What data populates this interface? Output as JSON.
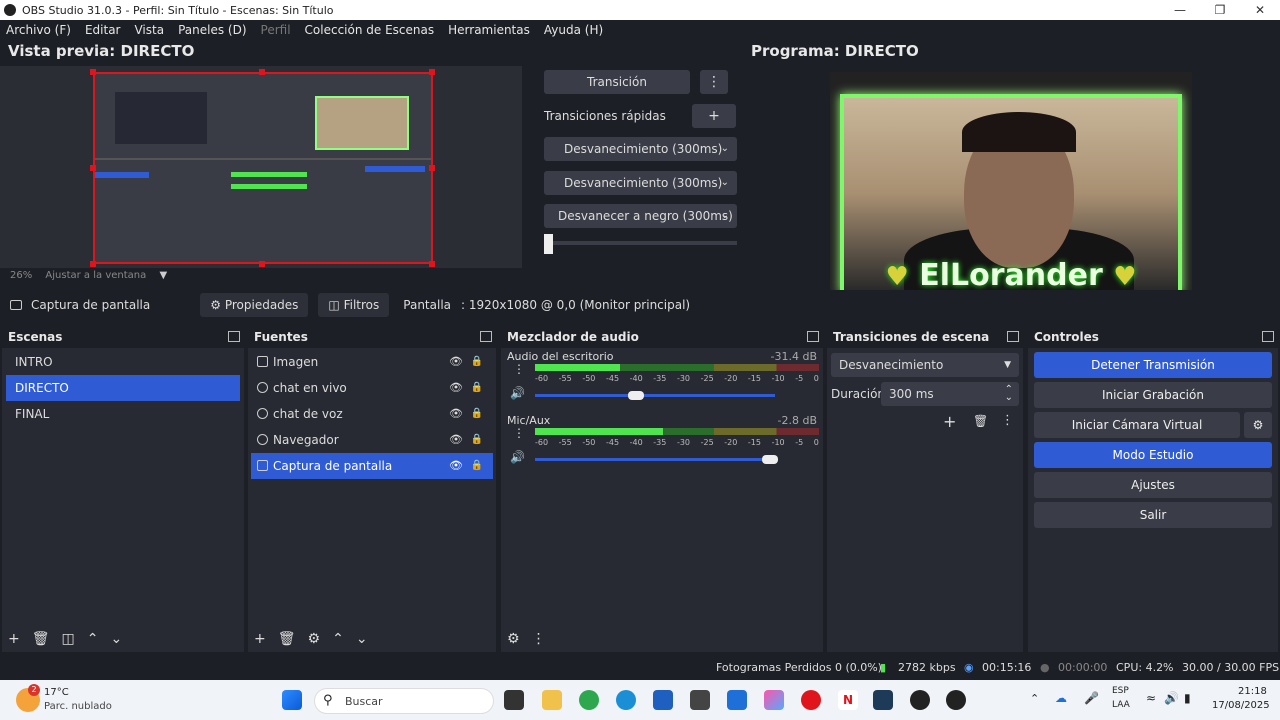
{
  "window": {
    "title": "OBS Studio 31.0.3 - Perfil: Sin Título - Escenas: Sin Título"
  },
  "menu": [
    "Archivo (F)",
    "Editar",
    "Vista",
    "Paneles (D)",
    "Perfil",
    "Colección de Escenas",
    "Herramientas",
    "Ayuda (H)"
  ],
  "preview": {
    "title": "Vista previa: DIRECTO",
    "zoom": "26%",
    "fit": "Ajustar a la ventana"
  },
  "program": {
    "title": "Programa: DIRECTO",
    "overlay_text": "ElLorander"
  },
  "transition_panel": {
    "transition_button": "Transición",
    "quick_label": "Transiciones rápidas",
    "quick": [
      "Desvanecimiento (300ms)",
      "Desvanecimiento (300ms)",
      "Desvanecer a negro (300ms)"
    ]
  },
  "source_bar": {
    "name": "Captura de pantalla",
    "properties": "Propiedades",
    "filters": "Filtros",
    "display_label": "Pantalla",
    "display_value": ": 1920x1080 @ 0,0 (Monitor principal)"
  },
  "scenes": {
    "title": "Escenas",
    "items": [
      "INTRO",
      "DIRECTO",
      "FINAL"
    ],
    "active_index": 1
  },
  "sources": {
    "title": "Fuentes",
    "items": [
      "Imagen",
      "chat en vivo",
      "chat de voz",
      "Navegador",
      "Captura de pantalla"
    ],
    "active_index": 4
  },
  "mixer": {
    "title": "Mezclador de audio",
    "scale": [
      "-60",
      "-55",
      "-50",
      "-45",
      "-40",
      "-35",
      "-30",
      "-25",
      "-20",
      "-15",
      "-10",
      "-5",
      "0"
    ],
    "channels": [
      {
        "name": "Audio del escritorio",
        "db": "-31.4 dB",
        "level": 0.3,
        "volume": 0.42
      },
      {
        "name": "Mic/Aux",
        "db": "-2.8 dB",
        "level": 0.45,
        "volume": 0.98
      }
    ]
  },
  "scene_transitions": {
    "title": "Transiciones de escena",
    "type": "Desvanecimiento",
    "duration_label": "Duración",
    "duration": "300 ms"
  },
  "controls": {
    "title": "Controles",
    "buttons": [
      {
        "label": "Detener Transmisión",
        "primary": true
      },
      {
        "label": "Iniciar Grabación",
        "primary": false
      },
      {
        "label": "Iniciar Cámara Virtual",
        "primary": false
      },
      {
        "label": "Modo Estudio",
        "primary": true
      },
      {
        "label": "Ajustes",
        "primary": false
      },
      {
        "label": "Salir",
        "primary": false
      }
    ]
  },
  "status": {
    "dropped": "Fotogramas Perdidos 0 (0.0%)",
    "bitrate": "2782 kbps",
    "stream_time": "00:15:16",
    "rec_time": "00:00:00",
    "cpu": "CPU: 4.2%",
    "fps": "30.00 / 30.00 FPS"
  },
  "taskbar": {
    "temp": "17°C",
    "weather": "Parc. nublado",
    "badge": "2",
    "search": "Buscar",
    "lang": "ESP",
    "layout": "LAA",
    "time": "21:18",
    "date": "17/08/2025"
  }
}
